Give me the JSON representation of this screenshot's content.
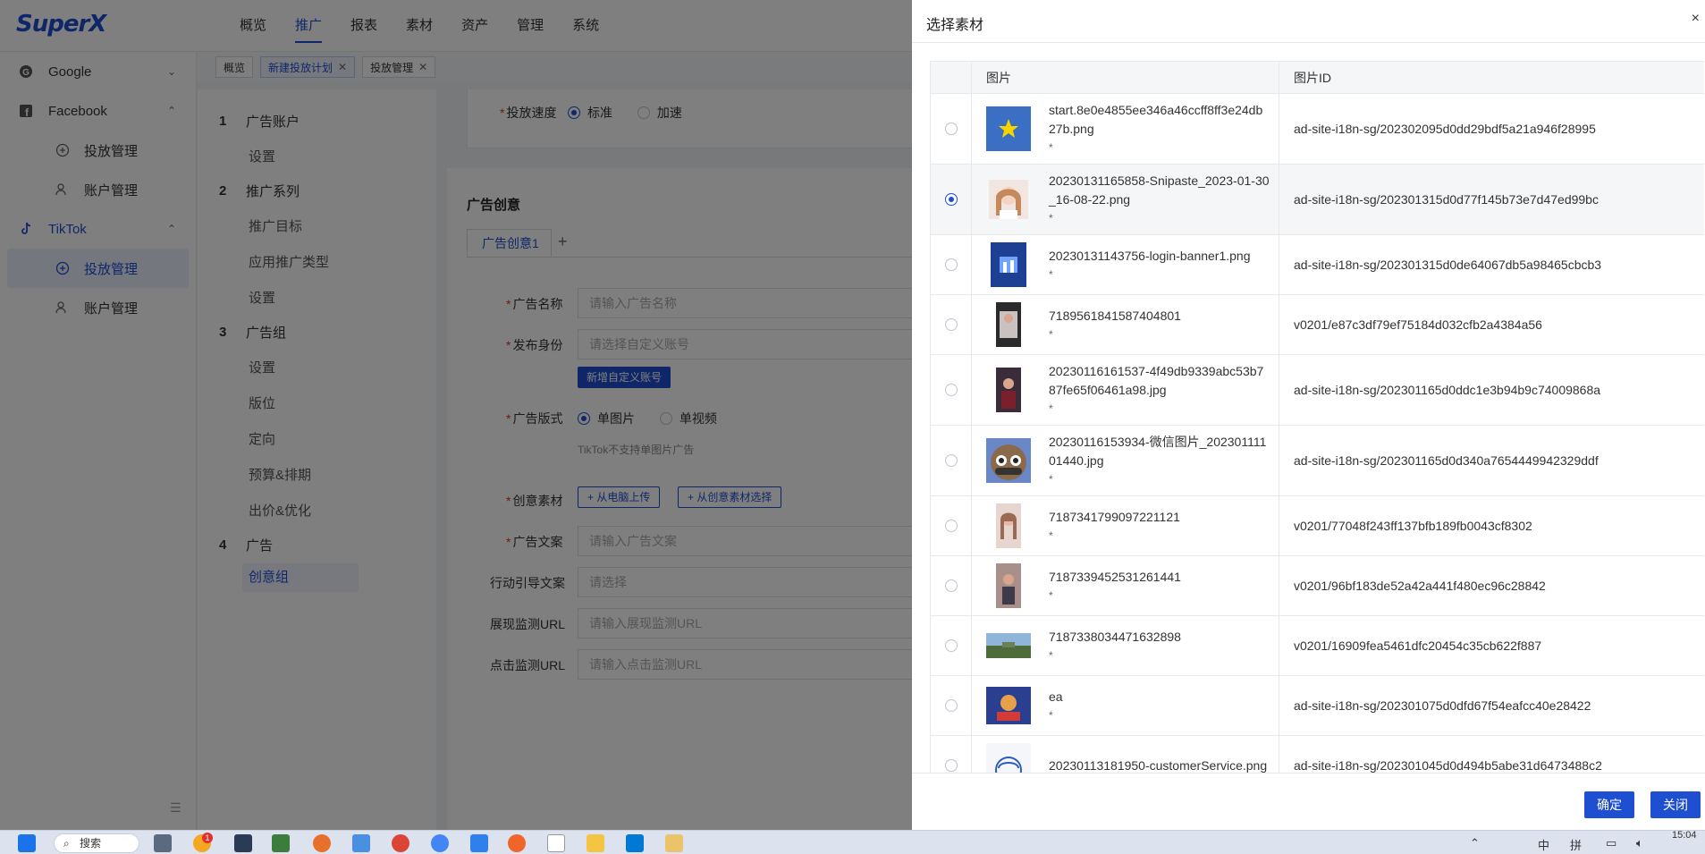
{
  "app": {
    "logo": "SuperX",
    "top_nav": [
      "概览",
      "推广",
      "报表",
      "素材",
      "资产",
      "管理",
      "系统"
    ],
    "top_nav_active": 1
  },
  "sidebar": {
    "groups": [
      {
        "label": "Google",
        "icon": "google-icon",
        "chevron": "chevron-down-icon",
        "items": []
      },
      {
        "label": "Facebook",
        "icon": "facebook-icon",
        "chevron": "chevron-up-icon",
        "items": [
          {
            "label": "投放管理",
            "icon": "campaign-icon"
          },
          {
            "label": "账户管理",
            "icon": "users-icon"
          }
        ]
      },
      {
        "label": "TikTok",
        "icon": "tiktok-icon",
        "chevron": "chevron-up-icon",
        "items": [
          {
            "label": "投放管理",
            "icon": "campaign-icon",
            "active": true
          },
          {
            "label": "账户管理",
            "icon": "users-icon"
          }
        ]
      }
    ]
  },
  "tabs": [
    {
      "label": "概览",
      "closable": false,
      "active": false
    },
    {
      "label": "新建投放计划",
      "closable": true,
      "active": true
    },
    {
      "label": "投放管理",
      "closable": true,
      "active": false
    }
  ],
  "steps": [
    {
      "num": "1",
      "title": "广告账户",
      "subs": [
        "设置"
      ]
    },
    {
      "num": "2",
      "title": "推广系列",
      "subs": [
        "推广目标",
        "应用推广类型",
        "设置"
      ]
    },
    {
      "num": "3",
      "title": "广告组",
      "subs": [
        "设置",
        "版位",
        "定向",
        "预算&排期",
        "出价&优化"
      ]
    },
    {
      "num": "4",
      "title": "广告",
      "subs": [
        "创意组"
      ]
    }
  ],
  "form": {
    "speed_label": "投放速度",
    "speed_options": [
      "标准",
      "加速"
    ],
    "section_title": "广告创意",
    "creative_tab": "广告创意1",
    "add_tab": "+",
    "ad_name_label": "广告名称",
    "ad_name_placeholder": "请输入广告名称",
    "identity_label": "发布身份",
    "identity_placeholder": "请选择自定义账号",
    "new_identity_button": "新增自定义账号",
    "format_label": "广告版式",
    "format_options": [
      "单图片",
      "单视频"
    ],
    "format_hint": "TikTok不支持单图片广告",
    "material_label": "创意素材",
    "upload_button": "+ 从电脑上传",
    "select_button": "+ 从创意素材选择",
    "ad_text_label": "广告文案",
    "ad_text_placeholder": "请输入广告文案",
    "cta_label": "行动引导文案",
    "cta_placeholder": "请选择",
    "impression_label": "展现监测URL",
    "impression_placeholder": "请输入展现监测URL",
    "click_label": "点击监测URL",
    "click_placeholder": "请输入点击监测URL"
  },
  "drawer": {
    "title": "选择素材",
    "close": "×",
    "columns": [
      "图片",
      "图片ID"
    ],
    "rows": [
      {
        "name": "start.8e0e4855ee346a46ccff8ff3e24db27b.png",
        "star": "*",
        "id": "ad-site-i18n-sg/202302095d0dd29bdf5a21a946f28995",
        "selected": false,
        "thumb": "star-thumb"
      },
      {
        "name": "20230131165858-Snipaste_2023-01-30_16-08-22.png",
        "star": "*",
        "id": "ad-site-i18n-sg/202301315d0d77f145b73e7d47ed99bc",
        "selected": true,
        "thumb": "portrait-thumb"
      },
      {
        "name": "20230131143756-login-banner1.png",
        "star": "*",
        "id": "ad-site-i18n-sg/202301315d0de64067db5a98465cbcb3",
        "selected": false,
        "thumb": "banner-thumb"
      },
      {
        "name": "7189561841587404801",
        "star": "*",
        "id": "v0201/e87c3df79ef75184d032cfb2a4384a56",
        "selected": false,
        "thumb": "video-thumb"
      },
      {
        "name": "20230116161537-4f49db9339abc53b787fe65f06461a98.jpg",
        "star": "*",
        "id": "ad-site-i18n-sg/202301165d0ddc1e3b94b9c74009868a",
        "selected": false,
        "thumb": "poster-thumb"
      },
      {
        "name": "20230116153934-微信图片_20230111101440.jpg",
        "star": "*",
        "id": "ad-site-i18n-sg/202301165d0d340a7654449942329ddf",
        "selected": false,
        "thumb": "mascot-thumb"
      },
      {
        "name": "7187341799097221121",
        "star": "*",
        "id": "v0201/77048f243ff137bfb189fb0043cf8302",
        "selected": false,
        "thumb": "person-thumb"
      },
      {
        "name": "7187339452531261441",
        "star": "*",
        "id": "v0201/96bf183de52a42a441f480ec96c28842",
        "selected": false,
        "thumb": "person2-thumb"
      },
      {
        "name": "7187338034471632898",
        "star": "*",
        "id": "v0201/16909fea5461dfc20454c35cb622f887",
        "selected": false,
        "thumb": "landscape-thumb"
      },
      {
        "name": "ea",
        "star": "*",
        "id": "ad-site-i18n-sg/202301075d0dfd67f54eafcc40e28422",
        "selected": false,
        "thumb": "game-thumb"
      },
      {
        "name": "20230113181950-customerService.png",
        "star": "",
        "id": "ad-site-i18n-sg/202301045d0d494b5abe31d6473488c2",
        "selected": false,
        "thumb": "service-thumb"
      }
    ],
    "confirm_button": "确定",
    "close_button": "关闭"
  },
  "taskbar": {
    "search": "搜索",
    "badge": "1",
    "tray_ime": "中",
    "tray_pinyin": "拼",
    "time": "15:04"
  }
}
